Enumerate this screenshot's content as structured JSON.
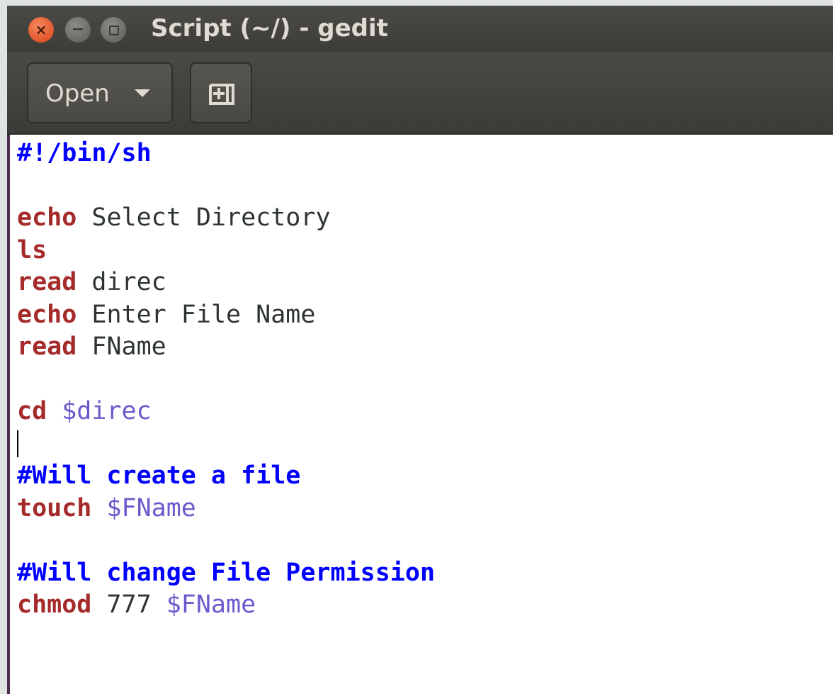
{
  "window": {
    "title": "Script (~/) - gedit"
  },
  "window_controls": {
    "close_glyph": "×",
    "minimize_glyph": "−"
  },
  "toolbar": {
    "open_label": "Open",
    "open_dropdown_icon": "caret-down-icon",
    "new_document_icon": "new-document-plus-icon"
  },
  "editor": {
    "lines": [
      {
        "comment": "#!/bin/sh"
      },
      {},
      {
        "keyword": "echo",
        "text": " Select Directory"
      },
      {
        "keyword": "ls"
      },
      {
        "keyword": "read",
        "text": " direc"
      },
      {
        "keyword": "echo",
        "text": " Enter File Name"
      },
      {
        "keyword": "read",
        "text": " FName"
      },
      {},
      {
        "keyword": "cd",
        "text": " ",
        "variable": "$direc"
      },
      {
        "cursor": true
      },
      {
        "comment": "#Will create a file"
      },
      {
        "keyword": "touch",
        "text": " ",
        "variable": "$FName"
      },
      {},
      {
        "comment": "#Will change File Permission"
      },
      {
        "keyword": "chmod",
        "text": " 777 ",
        "variable": "$FName"
      }
    ]
  },
  "colors": {
    "keyword": "#a52a2a",
    "comment": "#0000ff",
    "variable": "#6a5acd",
    "text": "#2e3436",
    "titlebar": "#3d3c38",
    "close_button": "#e2562c"
  }
}
